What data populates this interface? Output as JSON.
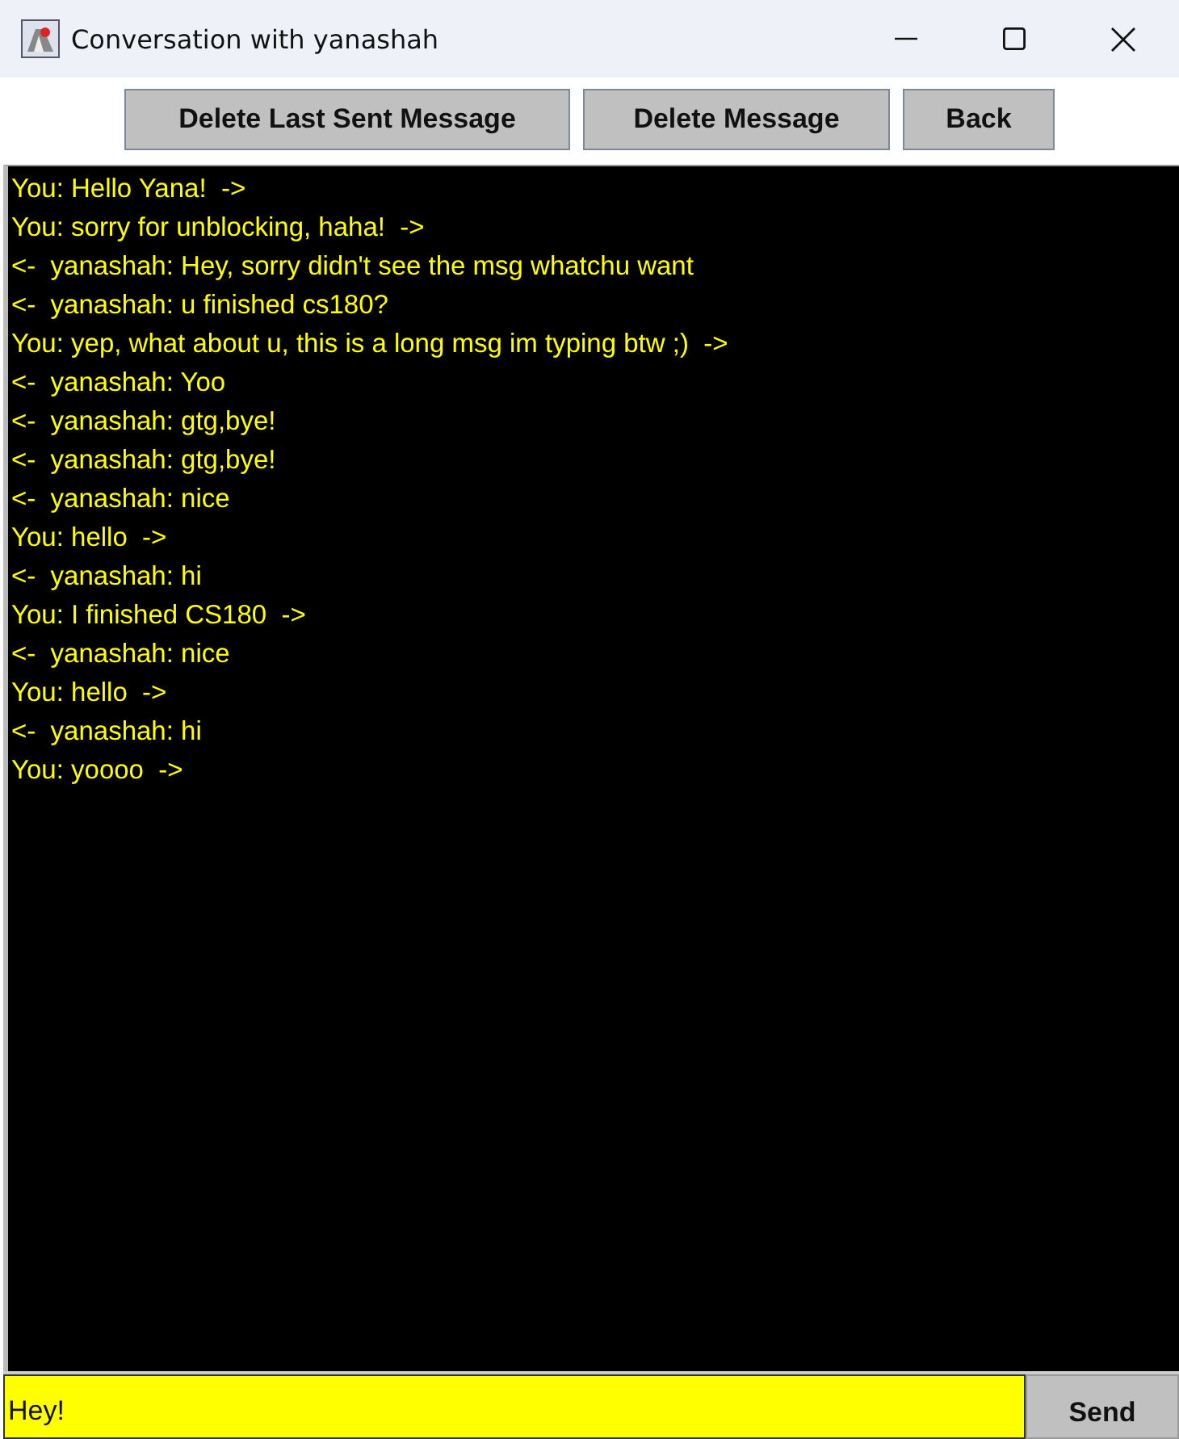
{
  "window": {
    "title": "Conversation with yanashah"
  },
  "buttons": [
    "Delete Last Sent Message",
    "Delete Message",
    "Back"
  ],
  "messages": [
    "You: Hello Yana!  ->",
    "You: sorry for unblocking, haha!  ->",
    "<-  yanashah: Hey, sorry didn't see the msg whatchu want",
    "<-  yanashah: u finished cs180?",
    "You: yep, what about u, this is a long msg im typing btw ;)  ->",
    "<-  yanashah: Yoo",
    "<-  yanashah: gtg,bye!",
    "<-  yanashah: gtg,bye!",
    "<-  yanashah: nice",
    "You: hello  ->",
    "<-  yanashah: hi",
    "You: I finished CS180  ->",
    "<-  yanashah: nice",
    "You: hello  ->",
    "<-  yanashah: hi",
    "You: yoooo  ->"
  ],
  "input": {
    "value": "Hey!"
  },
  "send_button": "Send"
}
